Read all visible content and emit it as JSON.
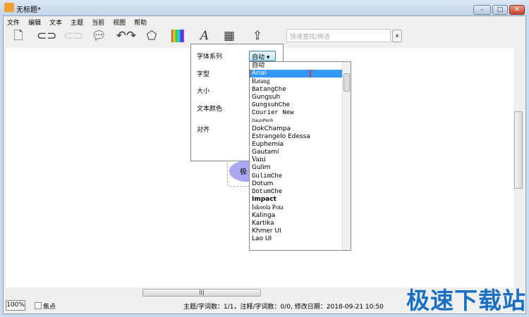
{
  "window": {
    "title": "无标题*",
    "controls": [
      "minimize",
      "maximize",
      "close"
    ]
  },
  "menu": [
    "文件",
    "编辑",
    "文本",
    "主题",
    "当前",
    "视图",
    "帮助"
  ],
  "toolbar": {
    "icons": [
      "new-document-icon",
      "subtopic-icon",
      "floating-topic-icon",
      "callout-icon",
      "relationship-icon",
      "boundary-icon",
      "color-icon",
      "font-icon",
      "table-icon",
      "export-icon"
    ],
    "search_placeholder": "快速查找/筛选",
    "clear_label": "x"
  },
  "canvas": {
    "node_text": "极"
  },
  "font_panel": {
    "labels": [
      "字体系列",
      "字型",
      "大小",
      "文本颜色",
      "对齐"
    ],
    "selected": "自动",
    "fonts": [
      "自动",
      "Arial",
      "Batang",
      "BatangChe",
      "Gungsuh",
      "GungsuhChe",
      "Courier New",
      "DaunPenh",
      "DokChampa",
      "Estrangelo Edessa",
      "Euphemia",
      "Gautami",
      "Vani",
      "Gulim",
      "GulimChe",
      "Dotum",
      "DotumChe",
      "Impact",
      "Iskoola Pota",
      "Kalinga",
      "Kartika",
      "Khmer UI",
      "Lao UI"
    ],
    "highlighted": "Arial"
  },
  "status": {
    "zoom": "100%",
    "focus_label": "焦点",
    "stats": "主题/字词数：1/1，注释/字词数：0/0, 修改日期：2018-09-21 10:50"
  },
  "watermark": "极速下载站"
}
